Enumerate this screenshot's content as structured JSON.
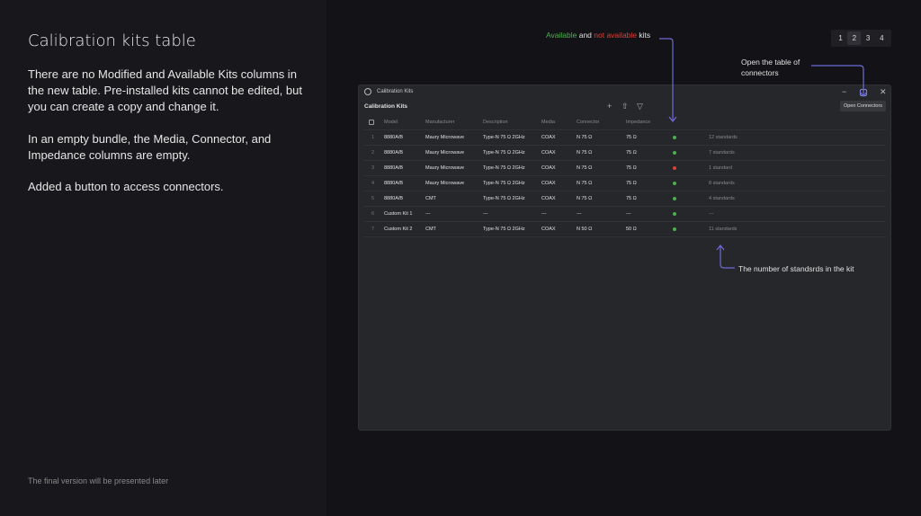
{
  "slide": {
    "title": "Calibration kits table",
    "paragraphs": [
      "There are no Modified and Available Kits columns in the new table. Pre-installed kits cannot be edited, but you can create a copy and change it.",
      "In an empty bundle, the Media, Connector, and Impedance columns are empty.",
      "Added a button to access connectors."
    ],
    "footer": "The final version will be presented later",
    "pages": [
      "1",
      "2",
      "3",
      "4"
    ],
    "current_page": "2"
  },
  "annotations": {
    "available": "Available",
    "and": "and",
    "not_available": "not available",
    "kits": "kits",
    "open_table": "Open the table of connectors",
    "standards_note": "The number of standsrds in the kit"
  },
  "window": {
    "title": "Calibration Kits",
    "heading": "Calibration Kits",
    "add_icon": "+",
    "export_icon": "⇧",
    "filter_icon": "▽",
    "minimize": "−",
    "close": "✕",
    "open_connectors": "Open Connectors",
    "columns": [
      "Model",
      "Manufacturer",
      "Description",
      "Media",
      "Connector",
      "Impedance"
    ],
    "rows": [
      {
        "n": "1",
        "model": "8880A/B",
        "mfr": "Maury Microwave",
        "desc": "Type-N 75 Ω 2GHz",
        "media": "COAX",
        "conn": "N 75 Ω",
        "imp": "75 Ω",
        "available": true,
        "std": "12 standards"
      },
      {
        "n": "2",
        "model": "8880A/B",
        "mfr": "Maury Microwave",
        "desc": "Type-N 75 Ω 2GHz",
        "media": "COAX",
        "conn": "N 75 Ω",
        "imp": "75 Ω",
        "available": true,
        "std": "7 standards"
      },
      {
        "n": "3",
        "model": "8880A/B",
        "mfr": "Maury Microwave",
        "desc": "Type-N 75 Ω 2GHz",
        "media": "COAX",
        "conn": "N 75 Ω",
        "imp": "75 Ω",
        "available": false,
        "std": "1 standard"
      },
      {
        "n": "4",
        "model": "8880A/B",
        "mfr": "Maury Microwave",
        "desc": "Type-N 75 Ω 2GHz",
        "media": "COAX",
        "conn": "N 75 Ω",
        "imp": "75 Ω",
        "available": true,
        "std": "8 standards"
      },
      {
        "n": "5",
        "model": "8880A/B",
        "mfr": "CMT",
        "desc": "Type-N 75 Ω 2GHz",
        "media": "COAX",
        "conn": "N 75 Ω",
        "imp": "75 Ω",
        "available": true,
        "std": "4 standards"
      },
      {
        "n": "6",
        "model": "Custom Kit 1",
        "mfr": "---",
        "desc": "---",
        "media": "---",
        "conn": "---",
        "imp": "---",
        "available": true,
        "std": "---"
      },
      {
        "n": "7",
        "model": "Custom Kit 2",
        "mfr": "CMT",
        "desc": "Type-N 75 Ω 2GHz",
        "media": "COAX",
        "conn": "N 50 Ω",
        "imp": "50 Ω",
        "available": true,
        "std": "11 standards"
      }
    ]
  },
  "colors": {
    "available": "#4caf50",
    "unavailable": "#d9413b",
    "arrow": "#6d6ad8"
  }
}
